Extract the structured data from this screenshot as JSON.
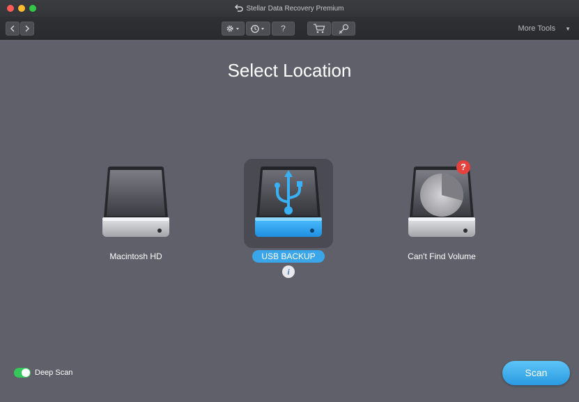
{
  "window": {
    "title": "Stellar Data Recovery Premium"
  },
  "toolbar": {
    "more_tools_label": "More Tools",
    "help_label": "?"
  },
  "page": {
    "title": "Select Location"
  },
  "drives": [
    {
      "label": "Macintosh HD"
    },
    {
      "label": "USB BACKUP",
      "selected": true
    },
    {
      "label": "Can't Find Volume"
    }
  ],
  "info_label": "i",
  "badge_label": "?",
  "deep_scan": {
    "label": "Deep Scan",
    "enabled": true
  },
  "scan_button": {
    "label": "Scan"
  },
  "colors": {
    "accent": "#3aa5e8",
    "toggle_on": "#35c759",
    "background": "#5f6069"
  }
}
